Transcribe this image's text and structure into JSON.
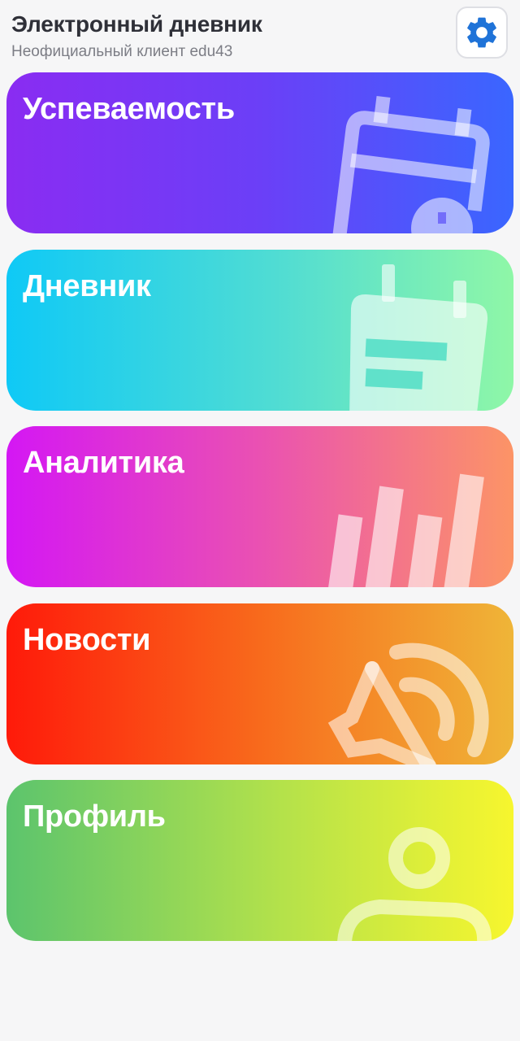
{
  "header": {
    "title": "Электронный дневник",
    "subtitle": "Неофициальный клиент edu43",
    "settings_icon": "gear-icon"
  },
  "cards": [
    {
      "id": "grades",
      "label": "Успеваемость",
      "icon": "calendar-info-icon",
      "gradient": [
        "#8a2cf2",
        "#3a66ff"
      ]
    },
    {
      "id": "diary",
      "label": "Дневник",
      "icon": "notepad-icon",
      "gradient": [
        "#0fc9f6",
        "#8ff7a7"
      ]
    },
    {
      "id": "analytics",
      "label": "Аналитика",
      "icon": "bar-chart-icon",
      "gradient": [
        "#d417f4",
        "#fc9466"
      ]
    },
    {
      "id": "news",
      "label": "Новости",
      "icon": "megaphone-icon",
      "gradient": [
        "#ff1a0a",
        "#efb538"
      ]
    },
    {
      "id": "profile",
      "label": "Профиль",
      "icon": "person-icon",
      "gradient": [
        "#5cc46d",
        "#f7f62e"
      ]
    }
  ],
  "colors": {
    "background": "#f6f6f7",
    "settings_accent": "#1f73d8",
    "title": "#2f3038",
    "subtitle": "#7c7d85"
  }
}
